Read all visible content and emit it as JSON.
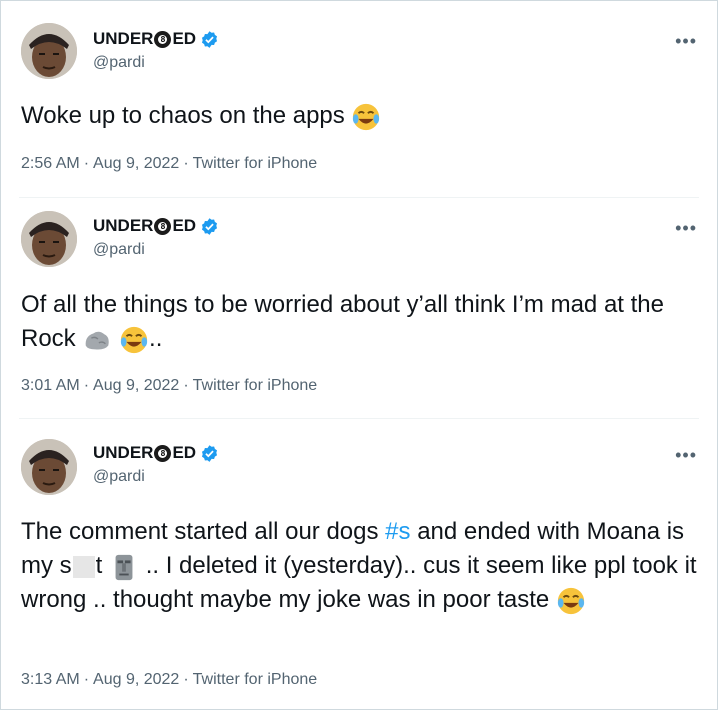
{
  "tweets": [
    {
      "name_left": "UNDER",
      "name_ball": "8",
      "name_right": "ED",
      "handle": "@pardi",
      "more": "•••",
      "text": "Woke up to chaos on the apps",
      "time": "2:56 AM",
      "date": "Aug 9, 2022",
      "source": "Twitter for iPhone"
    },
    {
      "name_left": "UNDER",
      "name_ball": "8",
      "name_right": "ED",
      "handle": "@pardi",
      "more": "•••",
      "text_a": "Of all the things to be worried about y’all think I’m mad at the Rock",
      "text_b": "..",
      "time": "3:01 AM",
      "date": "Aug 9, 2022",
      "source": "Twitter for iPhone"
    },
    {
      "name_left": "UNDER",
      "name_ball": "8",
      "name_right": "ED",
      "handle": "@pardi",
      "more": "•••",
      "text_a": "The comment started all our dogs ",
      "hashtag": "#s",
      "text_b": " and ended with Moana is my s",
      "text_c": "t",
      "text_d": ".. I deleted it (yesterday).. cus it seem like ppl took it wrong .. thought maybe my joke was in poor taste",
      "time": "3:13 AM",
      "date": "Aug 9, 2022",
      "source": "Twitter for iPhone"
    }
  ],
  "separator": "·",
  "colors": {
    "accent": "#1d9bf0",
    "muted": "#536471",
    "text": "#0f1419"
  },
  "icons": [
    "verified-badge-icon",
    "tears-of-joy-emoji",
    "rock-emoji",
    "moai-emoji",
    "eight-ball-icon"
  ]
}
